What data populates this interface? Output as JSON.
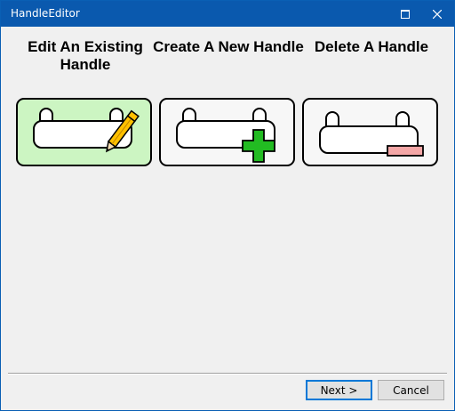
{
  "window": {
    "title": "HandleEditor",
    "maximize_icon": "maximize-icon",
    "close_icon": "close-icon"
  },
  "options": [
    {
      "label": "Edit An Existing Handle",
      "icon": "handle-edit-icon",
      "selected": true
    },
    {
      "label": "Create A New Handle",
      "icon": "handle-add-icon",
      "selected": false
    },
    {
      "label": "Delete A Handle",
      "icon": "handle-delete-icon",
      "selected": false
    }
  ],
  "footer": {
    "next_label": "Next >",
    "cancel_label": "Cancel"
  },
  "colors": {
    "titlebar": "#0a59ae",
    "selected_bg": "#ccf5c2",
    "pencil": "#ffc000",
    "plus": "#22bb22",
    "minus": "#f4a6a6"
  }
}
